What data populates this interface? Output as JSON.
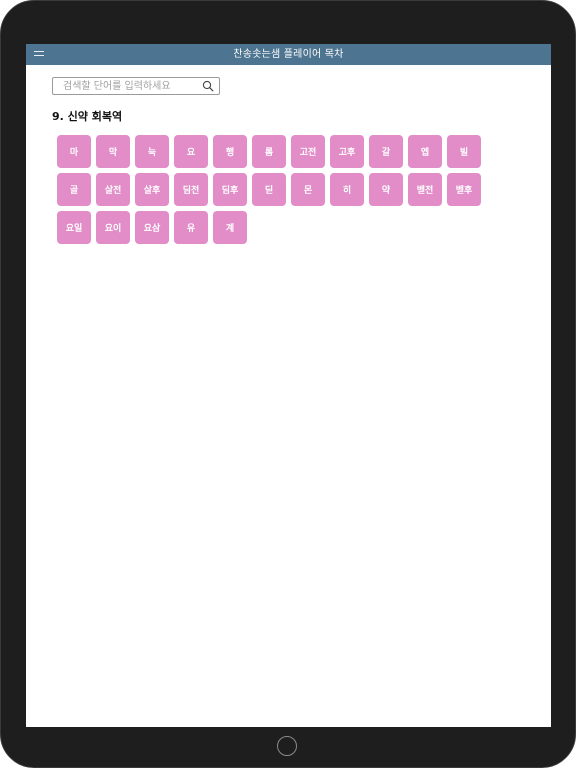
{
  "app": {
    "title": "찬송솟는샘 플레이어 목차"
  },
  "search": {
    "placeholder": "검색할 단어를 입력하세요",
    "value": ""
  },
  "section": {
    "title": "9. 신약 회복역",
    "items": [
      "마",
      "막",
      "눅",
      "요",
      "행",
      "롬",
      "고전",
      "고후",
      "갈",
      "엡",
      "빌",
      "골",
      "살전",
      "살후",
      "딤전",
      "딤후",
      "딛",
      "몬",
      "히",
      "약",
      "벧전",
      "벧후",
      "요일",
      "요이",
      "요삼",
      "유",
      "계"
    ]
  },
  "colors": {
    "titlebar": "#4d7490",
    "chip": "#e28dc8",
    "device": "#1e1e1e"
  }
}
